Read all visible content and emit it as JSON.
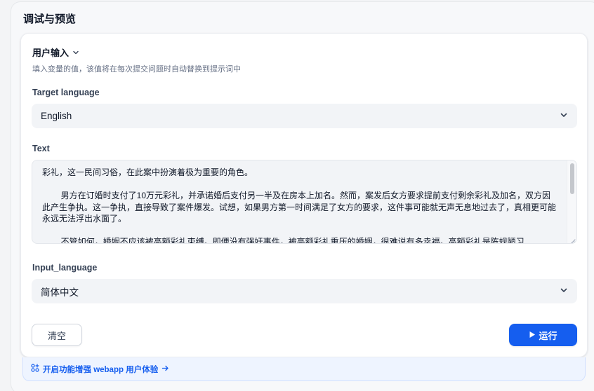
{
  "panel": {
    "title": "调试与预览"
  },
  "user_input": {
    "heading": "用户输入",
    "description": "填入变量的值，该值将在每次提交问题时自动替换到提示词中"
  },
  "fields": {
    "target_language": {
      "label": "Target language",
      "value": "English"
    },
    "text": {
      "label": "Text",
      "value": "彩礼，这一民间习俗，在此案中扮演着极为重要的角色。\n\n        男方在订婚时支付了10万元彩礼，并承诺婚后支付另一半及在房本上加名。然而，案发后女方要求提前支付剩余彩礼及加名，双方因此产生争执。这一争执，直接导致了案件爆发。试想，如果男方第一时间满足了女方的要求，这件事可能就无声无息地过去了，真相更可能永远无法浮出水面了。\n\n        不管如何，婚姻不应该被高额彩礼束缚。即便没有强奸事件，被高额彩礼重压的婚姻，很难说有多幸福。高额彩礼是陈规陋习"
    },
    "input_language": {
      "label": "Input_language",
      "value": "简体中文"
    }
  },
  "actions": {
    "clear_label": "清空",
    "run_label": "运行"
  },
  "enhance": {
    "label": "开启功能增强 webapp 用户体验"
  },
  "colors": {
    "accent": "#155eef",
    "enhance_bg": "#eef4ff",
    "field_bg": "#f2f4f7"
  },
  "icons": {
    "heading_chevron": "chevron-down-icon",
    "select_chevron": "chevron-down-icon",
    "run": "play-icon",
    "enhance": "feature-grid-icon",
    "enhance_arrow": "arrow-right-icon"
  }
}
